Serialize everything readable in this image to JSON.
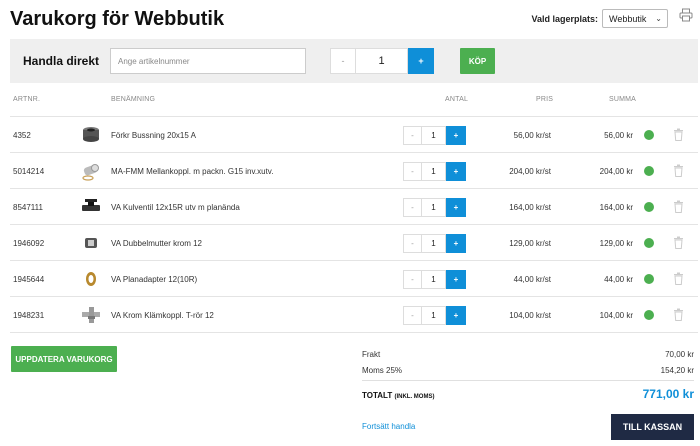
{
  "header": {
    "title": "Varukorg för Webbutik",
    "store_label": "Vald lagerplats:",
    "store_value": "Webbutik"
  },
  "quick_buy": {
    "label": "Handla direkt",
    "placeholder": "Ange artikelnummer",
    "minus": "-",
    "qty": "1",
    "plus": "+",
    "buy_label": "KÖP"
  },
  "table": {
    "headers": {
      "artnr": "ARTNR.",
      "name": "BENÄMNING",
      "qty": "ANTAL",
      "price": "PRIS",
      "sum": "SUMMA"
    },
    "rows": [
      {
        "artnr": "4352",
        "name": "Förkr Bussning 20x15 A",
        "qty": "1",
        "price": "56,00 kr/st",
        "sum": "56,00 kr",
        "icon": "bushing-icon"
      },
      {
        "artnr": "5014214",
        "name": "MA-FMM Mellankoppl. m packn. G15 inv.xutv.",
        "qty": "1",
        "price": "204,00 kr/st",
        "sum": "204,00 kr",
        "icon": "coupling-icon"
      },
      {
        "artnr": "8547111",
        "name": "VA Kulventil 12x15R utv m planända",
        "qty": "1",
        "price": "164,00 kr/st",
        "sum": "164,00 kr",
        "icon": "ball-valve-icon"
      },
      {
        "artnr": "1946092",
        "name": "VA Dubbelmutter krom 12",
        "qty": "1",
        "price": "129,00 kr/st",
        "sum": "129,00 kr",
        "icon": "double-nut-icon"
      },
      {
        "artnr": "1945644",
        "name": "VA Planadapter 12(10R)",
        "qty": "1",
        "price": "44,00 kr/st",
        "sum": "44,00 kr",
        "icon": "adapter-icon"
      },
      {
        "artnr": "1948231",
        "name": "VA Krom Klämkoppl. T-rör 12",
        "qty": "1",
        "price": "104,00 kr/st",
        "sum": "104,00 kr",
        "icon": "t-pipe-icon"
      }
    ],
    "minus": "-",
    "plus": "+"
  },
  "actions": {
    "update_label": "UPPDATERA VARUKORG",
    "continue_label": "Fortsätt handla",
    "checkout_label": "TILL KASSAN"
  },
  "totals": {
    "freight_label": "Frakt",
    "freight_value": "70,00 kr",
    "vat_label": "Moms 25%",
    "vat_value": "154,20 kr",
    "total_label": "TOTALT",
    "total_sub": "(INKL. MOMS)",
    "total_value": "771,00 kr"
  },
  "colors": {
    "accent_blue": "#0f8fd8",
    "green": "#4caf50",
    "navy": "#1f2a44"
  }
}
